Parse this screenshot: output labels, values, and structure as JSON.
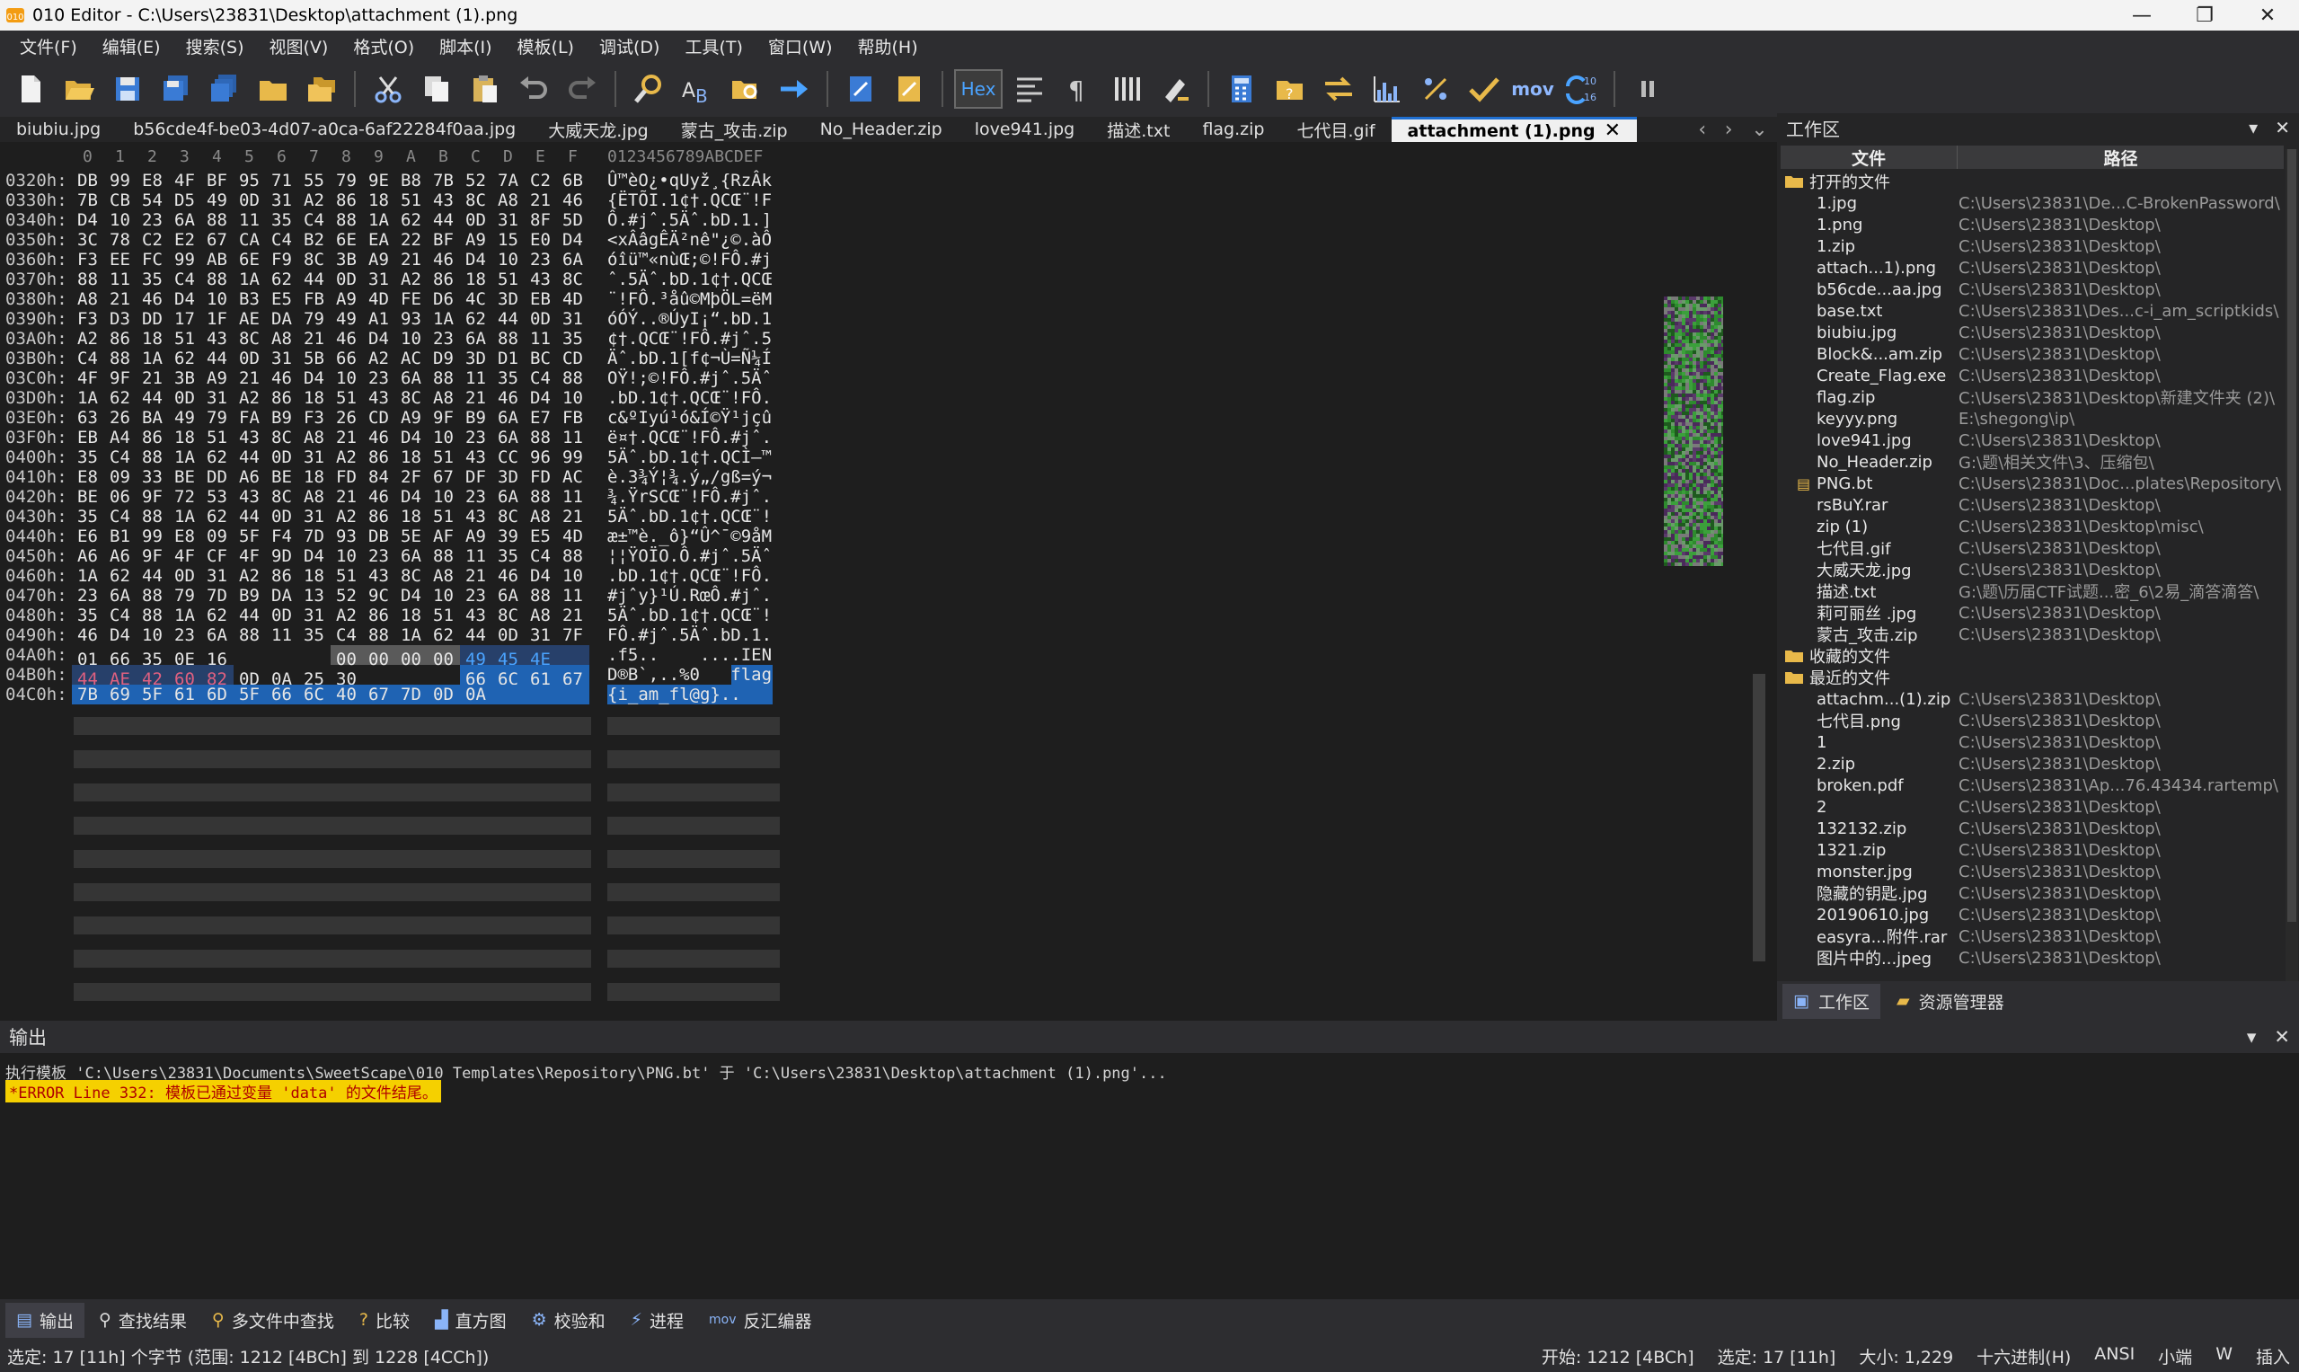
{
  "window": {
    "title": "010 Editor - C:\\Users\\23831\\Desktop\\attachment (1).png",
    "minimize": "—",
    "maximize": "❐",
    "close": "✕"
  },
  "menu": [
    "文件(F)",
    "编辑(E)",
    "搜索(S)",
    "视图(V)",
    "格式(O)",
    "脚本(I)",
    "模板(L)",
    "调试(D)",
    "工具(T)",
    "窗口(W)",
    "帮助(H)"
  ],
  "toolbar": {
    "hex_label": "Hex",
    "mov_label": "mov",
    "base_top": "10",
    "base_bottom": "16"
  },
  "tabs": [
    {
      "label": "biubiu.jpg",
      "active": false
    },
    {
      "label": "b56cde4f-be03-4d07-a0ca-6af22284f0aa.jpg",
      "active": false
    },
    {
      "label": "大威天龙.jpg",
      "active": false
    },
    {
      "label": "蒙古_攻击.zip",
      "active": false
    },
    {
      "label": "No_Header.zip",
      "active": false
    },
    {
      "label": "love941.jpg",
      "active": false
    },
    {
      "label": "描述.txt",
      "active": false
    },
    {
      "label": "flag.zip",
      "active": false
    },
    {
      "label": "七代目.gif",
      "active": false
    },
    {
      "label": "attachment (1).png",
      "active": true
    }
  ],
  "tab_close": "✕",
  "tab_nav": {
    "prev": "‹",
    "next": "›",
    "list": "⌄"
  },
  "hex_editor": {
    "column_headers": [
      "0",
      "1",
      "2",
      "3",
      "4",
      "5",
      "6",
      "7",
      "8",
      "9",
      "A",
      "B",
      "C",
      "D",
      "E",
      "F"
    ],
    "ascii_header": "0123456789ABCDEF",
    "rows": [
      {
        "addr": "0320h:",
        "hex": [
          "DB",
          "99",
          "E8",
          "4F",
          "BF",
          "95",
          "71",
          "55",
          "79",
          "9E",
          "B8",
          "7B",
          "52",
          "7A",
          "C2",
          "6B"
        ],
        "ascii": "Û™èO¿•qUyž¸{RzÂk"
      },
      {
        "addr": "0330h:",
        "hex": [
          "7B",
          "CB",
          "54",
          "D5",
          "49",
          "0D",
          "31",
          "A2",
          "86",
          "18",
          "51",
          "43",
          "8C",
          "A8",
          "21",
          "46"
        ],
        "ascii": "{ËTÕI.1¢†.QCŒ¨!F"
      },
      {
        "addr": "0340h:",
        "hex": [
          "D4",
          "10",
          "23",
          "6A",
          "88",
          "11",
          "35",
          "C4",
          "88",
          "1A",
          "62",
          "44",
          "0D",
          "31",
          "8F",
          "5D"
        ],
        "ascii": "Ô.#jˆ.5Äˆ.bD.1.]"
      },
      {
        "addr": "0350h:",
        "hex": [
          "3C",
          "78",
          "C2",
          "E2",
          "67",
          "CA",
          "C4",
          "B2",
          "6E",
          "EA",
          "22",
          "BF",
          "A9",
          "15",
          "E0",
          "D4"
        ],
        "ascii": "<xÂâgÊÄ²nê\"¿©.àÔ"
      },
      {
        "addr": "0360h:",
        "hex": [
          "F3",
          "EE",
          "FC",
          "99",
          "AB",
          "6E",
          "F9",
          "8C",
          "3B",
          "A9",
          "21",
          "46",
          "D4",
          "10",
          "23",
          "6A"
        ],
        "ascii": "óîü™«nùŒ;©!FÔ.#j"
      },
      {
        "addr": "0370h:",
        "hex": [
          "88",
          "11",
          "35",
          "C4",
          "88",
          "1A",
          "62",
          "44",
          "0D",
          "31",
          "A2",
          "86",
          "18",
          "51",
          "43",
          "8C"
        ],
        "ascii": "ˆ.5Äˆ.bD.1¢†.QCŒ"
      },
      {
        "addr": "0380h:",
        "hex": [
          "A8",
          "21",
          "46",
          "D4",
          "10",
          "B3",
          "E5",
          "FB",
          "A9",
          "4D",
          "FE",
          "D6",
          "4C",
          "3D",
          "EB",
          "4D"
        ],
        "ascii": "¨!FÔ.³åû©MþÖL=ëM"
      },
      {
        "addr": "0390h:",
        "hex": [
          "F3",
          "D3",
          "DD",
          "17",
          "1F",
          "AE",
          "DA",
          "79",
          "49",
          "A1",
          "93",
          "1A",
          "62",
          "44",
          "0D",
          "31"
        ],
        "ascii": "óÓÝ..®ÚyI¡“.bD.1"
      },
      {
        "addr": "03A0h:",
        "hex": [
          "A2",
          "86",
          "18",
          "51",
          "43",
          "8C",
          "A8",
          "21",
          "46",
          "D4",
          "10",
          "23",
          "6A",
          "88",
          "11",
          "35"
        ],
        "ascii": "¢†.QCŒ¨!FÔ.#jˆ.5"
      },
      {
        "addr": "03B0h:",
        "hex": [
          "C4",
          "88",
          "1A",
          "62",
          "44",
          "0D",
          "31",
          "5B",
          "66",
          "A2",
          "AC",
          "D9",
          "3D",
          "D1",
          "BC",
          "CD"
        ],
        "ascii": "Äˆ.bD.1[f¢¬Ù=Ñ¼Í"
      },
      {
        "addr": "03C0h:",
        "hex": [
          "4F",
          "9F",
          "21",
          "3B",
          "A9",
          "21",
          "46",
          "D4",
          "10",
          "23",
          "6A",
          "88",
          "11",
          "35",
          "C4",
          "88"
        ],
        "ascii": "OŸ!;©!FÔ.#jˆ.5Äˆ"
      },
      {
        "addr": "03D0h:",
        "hex": [
          "1A",
          "62",
          "44",
          "0D",
          "31",
          "A2",
          "86",
          "18",
          "51",
          "43",
          "8C",
          "A8",
          "21",
          "46",
          "D4",
          "10"
        ],
        "ascii": ".bD.1¢†.QCŒ¨!FÔ."
      },
      {
        "addr": "03E0h:",
        "hex": [
          "63",
          "26",
          "BA",
          "49",
          "79",
          "FA",
          "B9",
          "F3",
          "26",
          "CD",
          "A9",
          "9F",
          "B9",
          "6A",
          "E7",
          "FB"
        ],
        "ascii": "c&ºIyú¹ó&Í©Ÿ¹jçû"
      },
      {
        "addr": "03F0h:",
        "hex": [
          "EB",
          "A4",
          "86",
          "18",
          "51",
          "43",
          "8C",
          "A8",
          "21",
          "46",
          "D4",
          "10",
          "23",
          "6A",
          "88",
          "11"
        ],
        "ascii": "ë¤†.QCŒ¨!FÔ.#jˆ."
      },
      {
        "addr": "0400h:",
        "hex": [
          "35",
          "C4",
          "88",
          "1A",
          "62",
          "44",
          "0D",
          "31",
          "A2",
          "86",
          "18",
          "51",
          "43",
          "CC",
          "96",
          "99"
        ],
        "ascii": "5Äˆ.bD.1¢†.QCÌ–™"
      },
      {
        "addr": "0410h:",
        "hex": [
          "E8",
          "09",
          "33",
          "BE",
          "DD",
          "A6",
          "BE",
          "18",
          "FD",
          "84",
          "2F",
          "67",
          "DF",
          "3D",
          "FD",
          "AC"
        ],
        "ascii": "è.3¾Ý¦¾.ý„/gß=ý¬"
      },
      {
        "addr": "0420h:",
        "hex": [
          "BE",
          "06",
          "9F",
          "72",
          "53",
          "43",
          "8C",
          "A8",
          "21",
          "46",
          "D4",
          "10",
          "23",
          "6A",
          "88",
          "11"
        ],
        "ascii": "¾.ŸrSCŒ¨!FÔ.#jˆ."
      },
      {
        "addr": "0430h:",
        "hex": [
          "35",
          "C4",
          "88",
          "1A",
          "62",
          "44",
          "0D",
          "31",
          "A2",
          "86",
          "18",
          "51",
          "43",
          "8C",
          "A8",
          "21"
        ],
        "ascii": "5Äˆ.bD.1¢†.QCŒ¨!"
      },
      {
        "addr": "0440h:",
        "hex": [
          "E6",
          "B1",
          "99",
          "E8",
          "09",
          "5F",
          "F4",
          "7D",
          "93",
          "DB",
          "5E",
          "AF",
          "A9",
          "39",
          "E5",
          "4D"
        ],
        "ascii": "æ±™è._ô}“Û^¯©9åM"
      },
      {
        "addr": "0450h:",
        "hex": [
          "A6",
          "A6",
          "9F",
          "4F",
          "CF",
          "4F",
          "9D",
          "D4",
          "10",
          "23",
          "6A",
          "88",
          "11",
          "35",
          "C4",
          "88"
        ],
        "ascii": "¦¦ŸOÏO.Ô.#jˆ.5Äˆ"
      },
      {
        "addr": "0460h:",
        "hex": [
          "1A",
          "62",
          "44",
          "0D",
          "31",
          "A2",
          "86",
          "18",
          "51",
          "43",
          "8C",
          "A8",
          "21",
          "46",
          "D4",
          "10"
        ],
        "ascii": ".bD.1¢†.QCŒ¨!FÔ."
      },
      {
        "addr": "0470h:",
        "hex": [
          "23",
          "6A",
          "88",
          "79",
          "7D",
          "B9",
          "DA",
          "13",
          "52",
          "9C",
          "D4",
          "10",
          "23",
          "6A",
          "88",
          "11"
        ],
        "ascii": "#jˆy}¹Ú.RœÔ.#jˆ."
      },
      {
        "addr": "0480h:",
        "hex": [
          "35",
          "C4",
          "88",
          "1A",
          "62",
          "44",
          "0D",
          "31",
          "A2",
          "86",
          "18",
          "51",
          "43",
          "8C",
          "A8",
          "21"
        ],
        "ascii": "5Äˆ.bD.1¢†.QCŒ¨!"
      },
      {
        "addr": "0490h:",
        "hex": [
          "46",
          "D4",
          "10",
          "23",
          "6A",
          "88",
          "11",
          "35",
          "C4",
          "88",
          "1A",
          "62",
          "44",
          "0D",
          "31",
          "7F"
        ],
        "ascii": "FÔ.#jˆ.5Äˆ.bD.1."
      },
      {
        "addr": "04A0h:",
        "hex": [
          "01",
          "66",
          "35",
          "0E",
          "16",
          "",
          "",
          "",
          "00",
          "00",
          "00",
          "00",
          "49",
          "45",
          "4E",
          ""
        ],
        "ascii": ".f5..    ....IEN"
      },
      {
        "addr": "04B0h:",
        "hex": [
          "44",
          "AE",
          "42",
          "60",
          "82",
          "0D",
          "0A",
          "25",
          "30",
          "",
          "",
          "",
          "66",
          "6C",
          "61",
          "67"
        ],
        "ascii": "D®B`‚..%0   flag"
      },
      {
        "addr": "04C0h:",
        "hex": [
          "7B",
          "69",
          "5F",
          "61",
          "6D",
          "5F",
          "66",
          "6C",
          "40",
          "67",
          "7D",
          "0D",
          "0A"
        ],
        "ascii": "{i_am_fl@g}.."
      }
    ]
  },
  "workspace": {
    "title": "工作区",
    "col_file": "文件",
    "col_path": "路径",
    "sections": [
      {
        "label": "打开的文件",
        "items": [
          {
            "name": "1.jpg",
            "path": "C:\\Users\\23831\\De...C-BrokenPassword\\"
          },
          {
            "name": "1.png",
            "path": "C:\\Users\\23831\\Desktop\\"
          },
          {
            "name": "1.zip",
            "path": "C:\\Users\\23831\\Desktop\\"
          },
          {
            "name": "attach...1).png",
            "path": "C:\\Users\\23831\\Desktop\\"
          },
          {
            "name": "b56cde...aa.jpg",
            "path": "C:\\Users\\23831\\Desktop\\"
          },
          {
            "name": "base.txt",
            "path": "C:\\Users\\23831\\Des...c-i_am_scriptkids\\"
          },
          {
            "name": "biubiu.jpg",
            "path": "C:\\Users\\23831\\Desktop\\"
          },
          {
            "name": "Block&...am.zip",
            "path": "C:\\Users\\23831\\Desktop\\"
          },
          {
            "name": "Create_Flag.exe",
            "path": "C:\\Users\\23831\\Desktop\\"
          },
          {
            "name": "flag.zip",
            "path": "C:\\Users\\23831\\Desktop\\新建文件夹 (2)\\"
          },
          {
            "name": "keyyy.png",
            "path": "E:\\shegong\\ip\\"
          },
          {
            "name": "love941.jpg",
            "path": "C:\\Users\\23831\\Desktop\\"
          },
          {
            "name": "No_Header.zip",
            "path": "G:\\题\\相关文件\\3、压缩包\\"
          },
          {
            "name": "PNG.bt",
            "path": "C:\\Users\\23831\\Doc...plates\\Repository\\"
          },
          {
            "name": "rsBuY.rar",
            "path": "C:\\Users\\23831\\Desktop\\"
          },
          {
            "name": "zip (1)",
            "path": "C:\\Users\\23831\\Desktop\\misc\\"
          },
          {
            "name": "七代目.gif",
            "path": "C:\\Users\\23831\\Desktop\\"
          },
          {
            "name": "大威天龙.jpg",
            "path": "C:\\Users\\23831\\Desktop\\"
          },
          {
            "name": "描述.txt",
            "path": "G:\\题\\历届CTF试题...密_6\\2易_滴答滴答\\"
          },
          {
            "name": "莉可丽丝 .jpg",
            "path": "C:\\Users\\23831\\Desktop\\"
          },
          {
            "name": "蒙古_攻击.zip",
            "path": "C:\\Users\\23831\\Desktop\\"
          }
        ]
      },
      {
        "label": "收藏的文件",
        "items": []
      },
      {
        "label": "最近的文件",
        "items": [
          {
            "name": "attachm...(1).zip",
            "path": "C:\\Users\\23831\\Desktop\\"
          },
          {
            "name": "七代目.png",
            "path": "C:\\Users\\23831\\Desktop\\"
          },
          {
            "name": "1",
            "path": "C:\\Users\\23831\\Desktop\\"
          },
          {
            "name": "2.zip",
            "path": "C:\\Users\\23831\\Desktop\\"
          },
          {
            "name": "broken.pdf",
            "path": "C:\\Users\\23831\\Ap...76.43434.rartemp\\"
          },
          {
            "name": "2",
            "path": "C:\\Users\\23831\\Desktop\\"
          },
          {
            "name": "132132.zip",
            "path": "C:\\Users\\23831\\Desktop\\"
          },
          {
            "name": "1321.zip",
            "path": "C:\\Users\\23831\\Desktop\\"
          },
          {
            "name": "monster.jpg",
            "path": "C:\\Users\\23831\\Desktop\\"
          },
          {
            "name": "隐藏的钥匙.jpg",
            "path": "C:\\Users\\23831\\Desktop\\"
          },
          {
            "name": "20190610.jpg",
            "path": "C:\\Users\\23831\\Desktop\\"
          },
          {
            "name": "easyra...附件.rar",
            "path": "C:\\Users\\23831\\Desktop\\"
          },
          {
            "name": "图片中的...jpeg",
            "path": "C:\\Users\\23831\\Desktop\\"
          }
        ]
      }
    ],
    "tab_workspace": "工作区",
    "tab_explorer": "资源管理器"
  },
  "output": {
    "title": "输出",
    "line1": "执行模板 'C:\\Users\\23831\\Documents\\SweetScape\\010 Templates\\Repository\\PNG.bt' 于 'C:\\Users\\23831\\Desktop\\attachment (1).png'...",
    "error": "*ERROR Line 332: 模板已通过变量 'data' 的文件结尾。"
  },
  "bottom_tabs": [
    "输出",
    "查找结果",
    "多文件中查找",
    "比较",
    "直方图",
    "校验和",
    "进程",
    "反汇编器"
  ],
  "status": {
    "left": "选定: 17 [11h] 个字节 (范围: 1212 [4BCh] 到 1228 [4CCh])",
    "start": "开始: 1212 [4BCh]",
    "selected": "选定: 17 [11h]",
    "size": "大小: 1,229",
    "mode": "十六进制(H)",
    "encoding": "ANSI",
    "endian": "小端",
    "w": "W",
    "insert": "插入"
  },
  "colors": {
    "accent": "#1f63b3",
    "error_bg": "#f5d000",
    "error_fg": "#b00000",
    "pink_bytes": "#e06080"
  }
}
